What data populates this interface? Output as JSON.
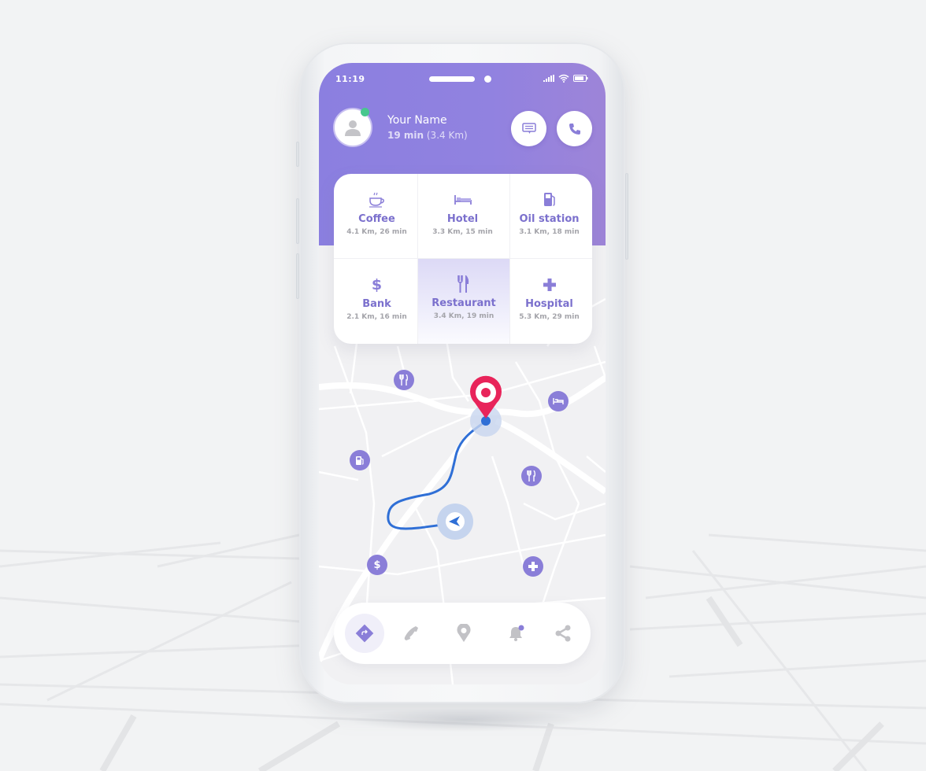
{
  "status_bar": {
    "time": "11:19"
  },
  "header": {
    "user_name": "Your Name",
    "eta_time": "19 min",
    "eta_distance": "(3.4 Km)",
    "online_color": "#48c78e",
    "accent_color": "#8b7fe0"
  },
  "actions": {
    "message_icon": "message-icon",
    "call_icon": "phone-icon"
  },
  "poi_categories": [
    {
      "icon": "coffee-icon",
      "label": "Coffee",
      "sub": "4.1 Km, 26 min",
      "active": false
    },
    {
      "icon": "hotel-bed-icon",
      "label": "Hotel",
      "sub": "3.3 Km, 15 min",
      "active": false
    },
    {
      "icon": "fuel-pump-icon",
      "label": "Oil station",
      "sub": "3.1 Km, 18 min",
      "active": false
    },
    {
      "icon": "dollar-icon",
      "label": "Bank",
      "sub": "2.1 Km, 16 min",
      "active": false
    },
    {
      "icon": "fork-knife-icon",
      "label": "Restaurant",
      "sub": "3.4 Km, 19 min",
      "active": true
    },
    {
      "icon": "cross-icon",
      "label": "Hospital",
      "sub": "5.3 Km, 29 min",
      "active": false
    }
  ],
  "map": {
    "route_color": "#2f6fd6",
    "destination_color": "#e8245a",
    "markers": [
      "restaurant",
      "hotel",
      "oil-station",
      "restaurant",
      "bank",
      "hospital"
    ]
  },
  "bottom_nav": [
    {
      "icon": "directions-icon",
      "active": true
    },
    {
      "icon": "phone-icon",
      "active": false
    },
    {
      "icon": "location-pin-icon",
      "active": false
    },
    {
      "icon": "bell-icon",
      "active": false,
      "badge": true
    },
    {
      "icon": "share-icon",
      "active": false
    }
  ]
}
